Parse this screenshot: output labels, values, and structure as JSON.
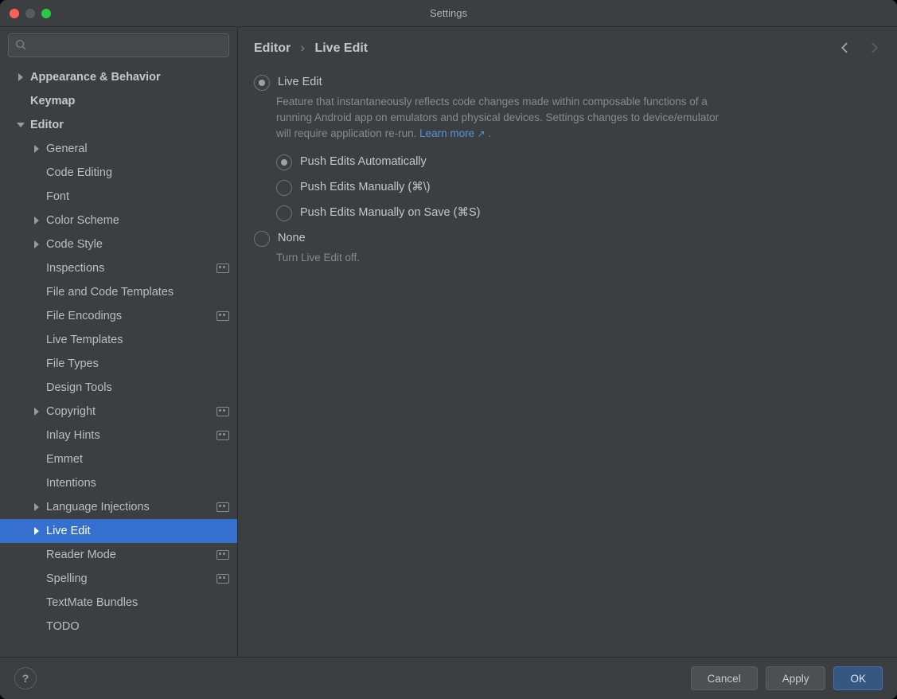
{
  "window": {
    "title": "Settings"
  },
  "search": {
    "placeholder": ""
  },
  "sidebar": {
    "items": [
      {
        "label": "Appearance & Behavior",
        "depth": 0,
        "hasChildren": true,
        "expanded": false,
        "bold": true
      },
      {
        "label": "Keymap",
        "depth": 0,
        "bold": true
      },
      {
        "label": "Editor",
        "depth": 0,
        "hasChildren": true,
        "expanded": true,
        "bold": true
      },
      {
        "label": "General",
        "depth": 1,
        "hasChildren": true,
        "expanded": false
      },
      {
        "label": "Code Editing",
        "depth": 1
      },
      {
        "label": "Font",
        "depth": 1
      },
      {
        "label": "Color Scheme",
        "depth": 1,
        "hasChildren": true,
        "expanded": false
      },
      {
        "label": "Code Style",
        "depth": 1,
        "hasChildren": true,
        "expanded": false
      },
      {
        "label": "Inspections",
        "depth": 1,
        "badge": true
      },
      {
        "label": "File and Code Templates",
        "depth": 1
      },
      {
        "label": "File Encodings",
        "depth": 1,
        "badge": true
      },
      {
        "label": "Live Templates",
        "depth": 1
      },
      {
        "label": "File Types",
        "depth": 1
      },
      {
        "label": "Design Tools",
        "depth": 1
      },
      {
        "label": "Copyright",
        "depth": 1,
        "hasChildren": true,
        "expanded": false,
        "badge": true
      },
      {
        "label": "Inlay Hints",
        "depth": 1,
        "badge": true
      },
      {
        "label": "Emmet",
        "depth": 1
      },
      {
        "label": "Intentions",
        "depth": 1
      },
      {
        "label": "Language Injections",
        "depth": 1,
        "hasChildren": true,
        "expanded": false,
        "badge": true
      },
      {
        "label": "Live Edit",
        "depth": 1,
        "hasChildren": true,
        "expanded": false,
        "selected": true
      },
      {
        "label": "Reader Mode",
        "depth": 1,
        "badge": true
      },
      {
        "label": "Spelling",
        "depth": 1,
        "badge": true
      },
      {
        "label": "TextMate Bundles",
        "depth": 1
      },
      {
        "label": "TODO",
        "depth": 1
      }
    ]
  },
  "breadcrumb": {
    "parent": "Editor",
    "current": "Live Edit"
  },
  "pane": {
    "liveEdit": {
      "label": "Live Edit",
      "description": "Feature that instantaneously reflects code changes made within composable functions of a running Android app on emulators and physical devices. Settings changes to device/emulator will require application re-run. ",
      "learnMore": "Learn more",
      "descSuffix": " .",
      "checked": true,
      "options": [
        {
          "label": "Push Edits Automatically",
          "checked": true
        },
        {
          "label": "Push Edits Manually (⌘\\)",
          "checked": false
        },
        {
          "label": "Push Edits Manually on Save (⌘S)",
          "checked": false
        }
      ]
    },
    "none": {
      "label": "None",
      "description": "Turn Live Edit off.",
      "checked": false
    }
  },
  "footer": {
    "cancel": "Cancel",
    "apply": "Apply",
    "ok": "OK"
  }
}
